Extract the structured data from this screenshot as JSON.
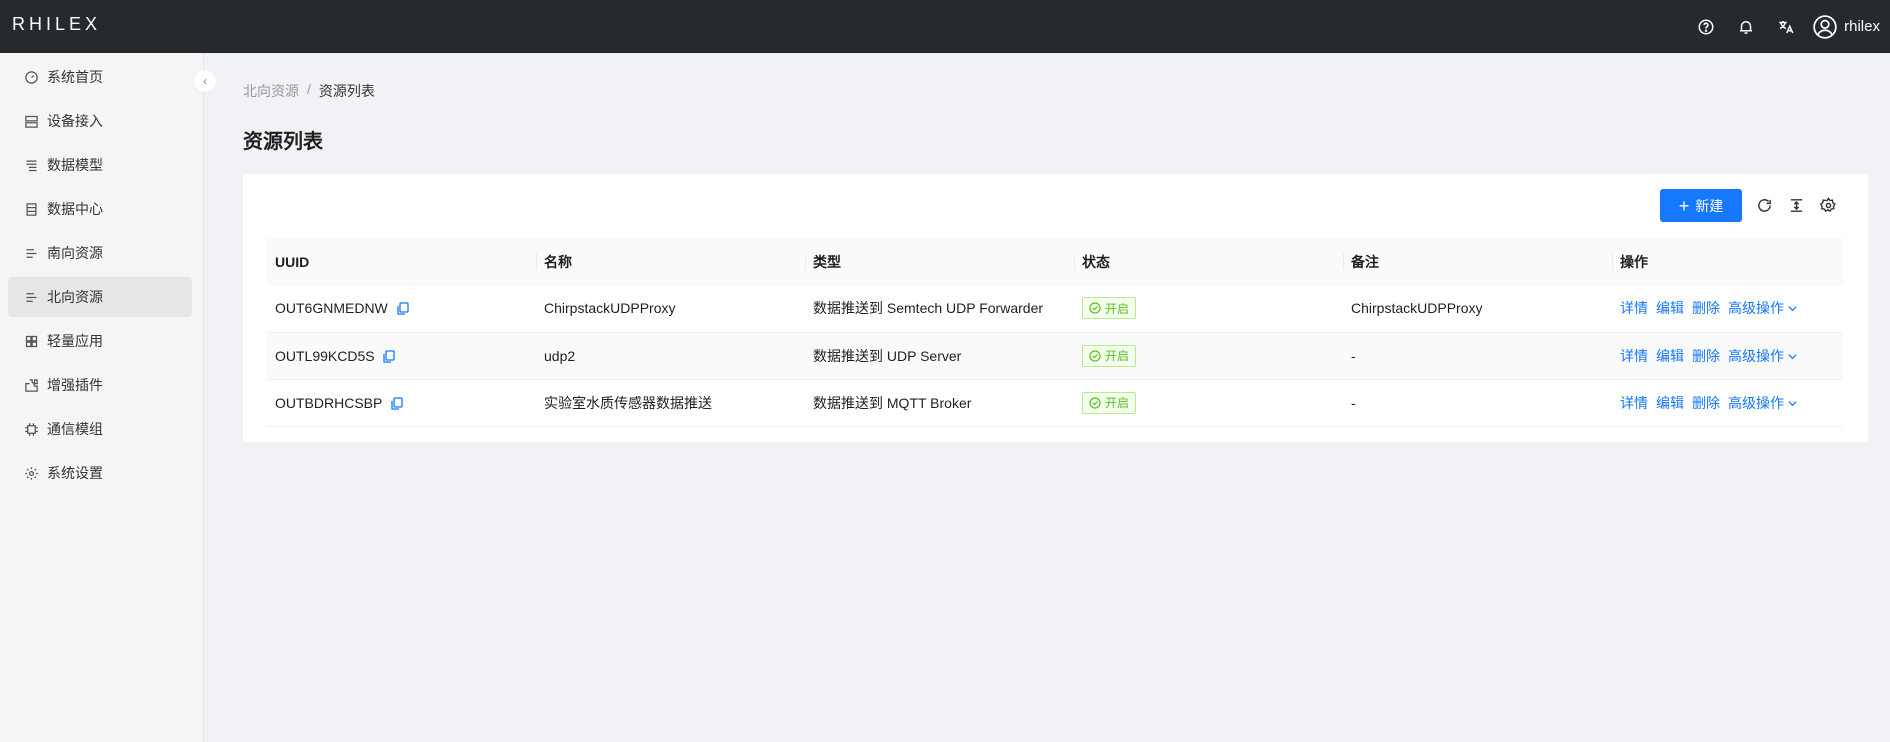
{
  "app": {
    "logo": "RHILEX",
    "user_name": "rhilex"
  },
  "header_icons": [
    "help-icon",
    "bell-icon",
    "translate-icon",
    "user-icon"
  ],
  "sidebar": {
    "items": [
      {
        "label": "系统首页",
        "icon": "dashboard-icon"
      },
      {
        "label": "设备接入",
        "icon": "device-icon"
      },
      {
        "label": "数据模型",
        "icon": "model-icon"
      },
      {
        "label": "数据中心",
        "icon": "database-icon"
      },
      {
        "label": "南向资源",
        "icon": "list-icon"
      },
      {
        "label": "北向资源",
        "icon": "list-icon"
      },
      {
        "label": "轻量应用",
        "icon": "app-icon"
      },
      {
        "label": "增强插件",
        "icon": "plugin-icon"
      },
      {
        "label": "通信模组",
        "icon": "chip-icon"
      },
      {
        "label": "系统设置",
        "icon": "gear-icon"
      }
    ],
    "active_index": 5
  },
  "breadcrumb": {
    "parent": "北向资源",
    "separator": "/",
    "current": "资源列表"
  },
  "page": {
    "title": "资源列表"
  },
  "toolbar": {
    "new_label": "新建"
  },
  "table": {
    "headers": [
      "UUID",
      "名称",
      "类型",
      "状态",
      "备注",
      "操作"
    ],
    "rows": [
      {
        "uuid": "OUT6GNMEDNW",
        "name": "ChirpstackUDPProxy",
        "type": "数据推送到 Semtech UDP Forwarder",
        "status": "开启",
        "remark": "ChirpstackUDPProxy"
      },
      {
        "uuid": "OUTL99KCD5S",
        "name": "udp2",
        "type": "数据推送到 UDP Server",
        "status": "开启",
        "remark": "-"
      },
      {
        "uuid": "OUTBDRHCSBP",
        "name": "实验室水质传感器数据推送",
        "type": "数据推送到 MQTT Broker",
        "status": "开启",
        "remark": "-"
      }
    ],
    "actions": {
      "detail": "详情",
      "edit": "编辑",
      "delete": "删除",
      "advanced": "高级操作"
    }
  },
  "colors": {
    "topbar": "#262a2f",
    "primary": "#1677ff",
    "success": "#52c41a"
  }
}
